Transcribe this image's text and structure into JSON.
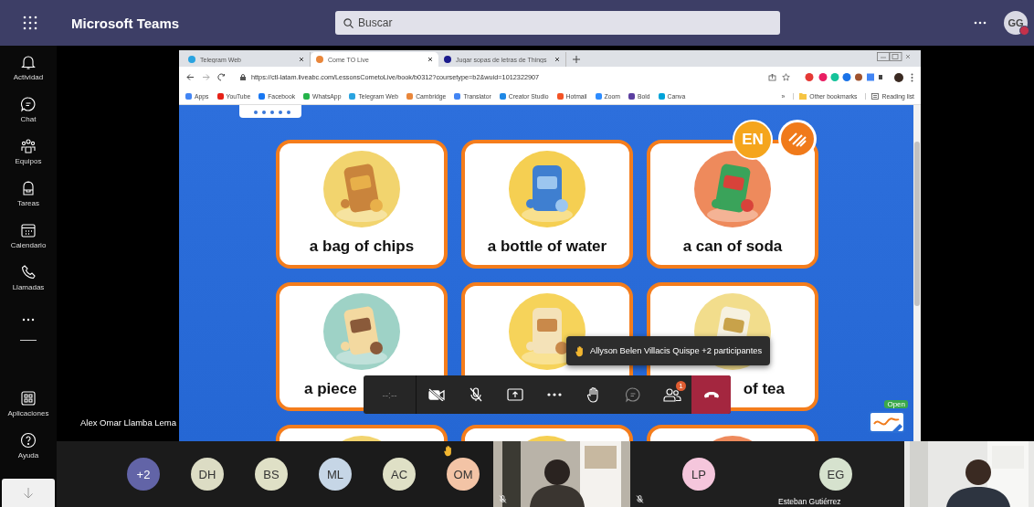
{
  "app": {
    "title": "Microsoft Teams",
    "search": {
      "placeholder": "Buscar"
    },
    "user": {
      "initials": "GG",
      "busy": true
    }
  },
  "rail": {
    "items": [
      {
        "label": "Actividad",
        "selected": false
      },
      {
        "label": "Chat",
        "selected": false
      },
      {
        "label": "Equipos",
        "selected": false
      },
      {
        "label": "Tareas",
        "selected": false
      },
      {
        "label": "Calendario",
        "selected": false
      },
      {
        "label": "Llamadas",
        "selected": false
      }
    ],
    "bottom_items": [
      {
        "label": "Aplicaciones",
        "selected": false
      },
      {
        "label": "Ayuda",
        "selected": false
      }
    ]
  },
  "browser": {
    "tabs": [
      {
        "title": "Telegram Web",
        "selected": false,
        "color": "#2aa3e0"
      },
      {
        "title": "Come TO Live",
        "selected": true,
        "color": "#e9863a"
      },
      {
        "title": "Jugar sopas de letras de Things",
        "selected": false,
        "color": "#1a1a8c"
      }
    ],
    "url": "https://ctl-latam.liveabc.com/LessonsCometoLive/book/b0312?coursetype=b2&wuid=1012322907",
    "bookmarks": [
      {
        "label": "Apps",
        "color": "#4285f4"
      },
      {
        "label": "YouTube",
        "color": "#e62117"
      },
      {
        "label": "Facebook",
        "color": "#1877f2"
      },
      {
        "label": "WhatsApp",
        "color": "#25b34a"
      },
      {
        "label": "Telegram Web",
        "color": "#2aa3e0"
      },
      {
        "label": "Cambridge",
        "color": "#e9863a"
      },
      {
        "label": "Translator",
        "color": "#4285f4"
      },
      {
        "label": "Creator Studio",
        "color": "#1e88e5"
      },
      {
        "label": "Hotmail",
        "color": "#f35325"
      },
      {
        "label": "Zoom",
        "color": "#2d8cff"
      },
      {
        "label": "Bold",
        "color": "#5b3fa0"
      },
      {
        "label": "Canva",
        "color": "#00a3d9"
      }
    ],
    "bookmarks_overflow": "»",
    "other_bookmarks": "Other bookmarks",
    "reading_list": "Reading list"
  },
  "lesson": {
    "badge": "EN",
    "open_button": "Open",
    "cards": [
      {
        "kind": "picture",
        "label": "a bag of chips"
      },
      {
        "kind": "picture",
        "label": "a bottle of water"
      },
      {
        "kind": "picture",
        "label": "a can of soda"
      },
      {
        "kind": "picture",
        "label": "a piece"
      },
      {
        "kind": "picture"
      },
      {
        "kind": "picture",
        "label": "of tea"
      },
      {
        "kind": "picture"
      },
      {
        "kind": "picture"
      },
      {
        "kind": "picture"
      }
    ]
  },
  "speaker_label": "Alex Omar Llamba Lema",
  "call_controls": {
    "items": [
      {
        "kind": "timer",
        "text": "--:--"
      },
      {
        "kind": "camera",
        "on": false
      },
      {
        "kind": "mic",
        "on": false
      },
      {
        "kind": "share"
      },
      {
        "kind": "more"
      },
      {
        "kind": "hand"
      },
      {
        "kind": "chat"
      },
      {
        "kind": "people",
        "badge": "1"
      },
      {
        "kind": "hangup"
      }
    ],
    "tooltip": "Allyson Belen Villacis Quispe +2 participantes"
  },
  "gallery": {
    "avatars": [
      {
        "initials": "+2",
        "color": "#6264a7",
        "hand_raised": false
      },
      {
        "initials": "DH",
        "color": "#dcdcc4",
        "hand_raised": false
      },
      {
        "initials": "BS",
        "color": "#dfe0c6",
        "hand_raised": false
      },
      {
        "initials": "ML",
        "color": "#c6d6e6",
        "hand_raised": false
      },
      {
        "initials": "AC",
        "color": "#dfe0c6",
        "hand_raised": false
      },
      {
        "initials": "OM",
        "color": "#f3c4a6",
        "hand_raised": true
      }
    ],
    "tiles": [
      {
        "kind": "video",
        "muted": true
      },
      {
        "kind": "avatar",
        "initials": "LP",
        "color": "#f5c6dc",
        "muted": true
      },
      {
        "kind": "avatar",
        "initials": "EG",
        "color": "#d6e2ce",
        "muted": false,
        "name": "Esteban Gutiérrez"
      },
      {
        "kind": "video",
        "muted": false
      }
    ]
  }
}
